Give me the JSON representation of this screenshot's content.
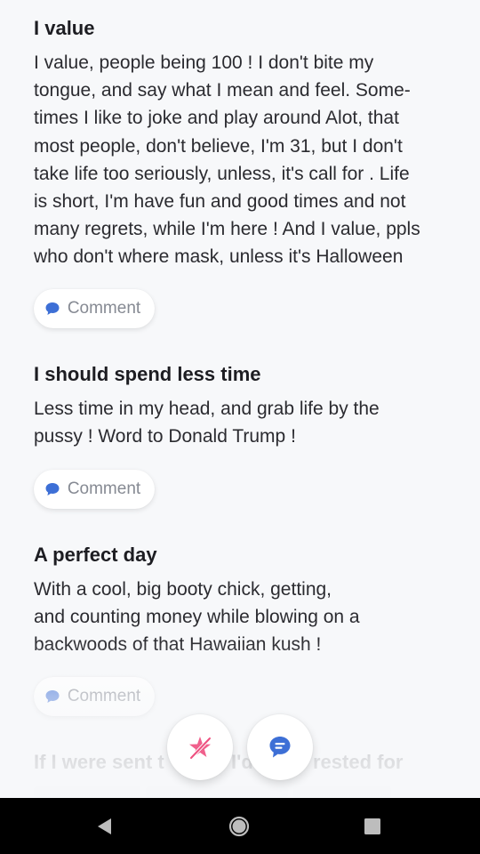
{
  "sections": [
    {
      "title": "I value",
      "body": "I value, people being 100 ! I don't bite my\ntongue, and say what I mean and feel. Some-\ntimes I like to joke and play around Alot, that\nmost people, don't believe, I'm 31, but I don't\ntake life too seriously, unless, it's call for . Life\nis short, I'm have fun and good times and not\nmany regrets, while I'm here ! And I value, ppls\nwho don't where mask, unless it's Halloween",
      "comment_label": "Comment"
    },
    {
      "title": "I should spend less time",
      "body": "Less time in my head, and grab life by the\npussy ! Word to Donald Trump !",
      "comment_label": "Comment"
    },
    {
      "title": "A perfect day",
      "body": "With a cool, big booty chick, getting,\nand counting money while blowing on a\nbackwoods of that Hawaiian kush !",
      "comment_label": "Comment"
    },
    {
      "title": "If I were sent t",
      "title_tail": "I'd",
      "title_tail2": "rested for"
    }
  ],
  "fabs": {
    "skip_icon": "crossed-star-icon",
    "message_icon": "chat-bubble-icon"
  },
  "colors": {
    "accent_blue": "#3d6fd6",
    "skip_pink": "#ee4f7f",
    "background": "#f7f8fa"
  },
  "navbar": {
    "back_icon": "back-triangle-icon",
    "home_icon": "home-circle-icon",
    "recents_icon": "recents-square-icon"
  }
}
